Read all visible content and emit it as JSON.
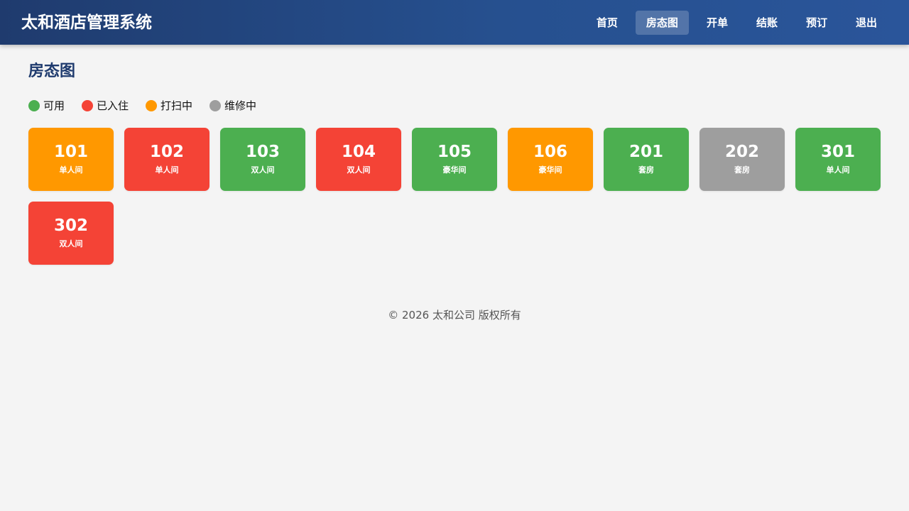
{
  "header": {
    "title": "太和酒店管理系统",
    "nav": [
      {
        "label": "首页",
        "name": "nav-home",
        "active": false
      },
      {
        "label": "房态图",
        "name": "nav-room-status",
        "active": true
      },
      {
        "label": "开单",
        "name": "nav-check-in",
        "active": false
      },
      {
        "label": "结账",
        "name": "nav-checkout",
        "active": false
      },
      {
        "label": "预订",
        "name": "nav-booking",
        "active": false
      },
      {
        "label": "退出",
        "name": "nav-logout",
        "active": false
      }
    ]
  },
  "main": {
    "title": "房态图",
    "legend": [
      {
        "label": "可用",
        "color": "#4caf50"
      },
      {
        "label": "已入住",
        "color": "#f44336"
      },
      {
        "label": "打扫中",
        "color": "#ff9800"
      },
      {
        "label": "维修中",
        "color": "#9e9e9e"
      }
    ],
    "rooms": [
      {
        "number": "101",
        "type": "单人间",
        "color": "#ff9800"
      },
      {
        "number": "102",
        "type": "单人间",
        "color": "#f44336"
      },
      {
        "number": "103",
        "type": "双人间",
        "color": "#4caf50"
      },
      {
        "number": "104",
        "type": "双人间",
        "color": "#f44336"
      },
      {
        "number": "105",
        "type": "豪华间",
        "color": "#4caf50"
      },
      {
        "number": "106",
        "type": "豪华间",
        "color": "#ff9800"
      },
      {
        "number": "201",
        "type": "套房",
        "color": "#4caf50"
      },
      {
        "number": "202",
        "type": "套房",
        "color": "#9e9e9e"
      },
      {
        "number": "301",
        "type": "单人间",
        "color": "#4caf50"
      },
      {
        "number": "302",
        "type": "双人间",
        "color": "#f44336"
      }
    ]
  },
  "footer": {
    "text": "© 2026 太和公司 版权所有"
  }
}
